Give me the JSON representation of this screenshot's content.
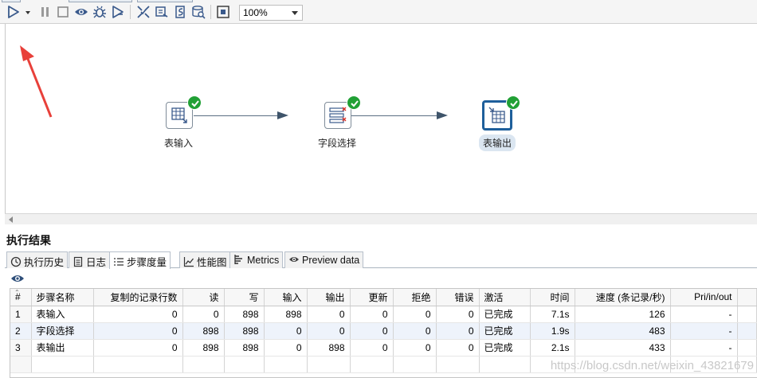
{
  "toolbar": {
    "icons": [
      "run-icon",
      "run-options-icon",
      "pause-icon",
      "stop-icon",
      "preview-icon",
      "debug-icon",
      "replay-icon",
      "verify-icon",
      "impact-icon",
      "sql-icon",
      "explore-db-icon",
      "show-results-icon"
    ],
    "zoom": "100%"
  },
  "canvas": {
    "steps": [
      {
        "label": "表输入",
        "icon": "table-input-icon",
        "status": "ok"
      },
      {
        "label": "字段选择",
        "icon": "select-values-icon",
        "status": "ok"
      },
      {
        "label": "表输出",
        "icon": "table-output-icon",
        "status": "ok",
        "selected": true
      }
    ],
    "annotation_color": "#e8403a"
  },
  "results": {
    "title": "执行结果",
    "tabs": [
      {
        "label": "执行历史",
        "icon": "history-icon"
      },
      {
        "label": "日志",
        "icon": "log-icon"
      },
      {
        "label": "步骤度量",
        "icon": "step-metrics-icon",
        "active": true
      },
      {
        "label": "性能图",
        "icon": "perf-graph-icon"
      },
      {
        "label": "Metrics",
        "icon": "metrics-icon"
      },
      {
        "label": "Preview data",
        "icon": "preview-eye-icon"
      }
    ],
    "columns": [
      "#",
      "步骤名称",
      "复制的记录行数",
      "读",
      "写",
      "输入",
      "输出",
      "更新",
      "拒绝",
      "错误",
      "激活",
      "时间",
      "速度 (条记录/秒)",
      "Pri/in/out"
    ],
    "rows": [
      [
        "1",
        "表输入",
        "0",
        "0",
        "898",
        "898",
        "0",
        "0",
        "0",
        "0",
        "已完成",
        "7.1s",
        "126",
        "-"
      ],
      [
        "2",
        "字段选择",
        "0",
        "898",
        "898",
        "0",
        "0",
        "0",
        "0",
        "0",
        "已完成",
        "1.9s",
        "483",
        "-"
      ],
      [
        "3",
        "表输出",
        "0",
        "898",
        "898",
        "0",
        "898",
        "0",
        "0",
        "0",
        "已完成",
        "2.1s",
        "433",
        "-"
      ]
    ]
  },
  "watermark": "https://blog.csdn.net/weixin_43821679",
  "colors": {
    "ok": "#21a035",
    "hop": "#3e546a",
    "selected_border": "#1e5f9b",
    "alt_row": "#eef3fb"
  }
}
